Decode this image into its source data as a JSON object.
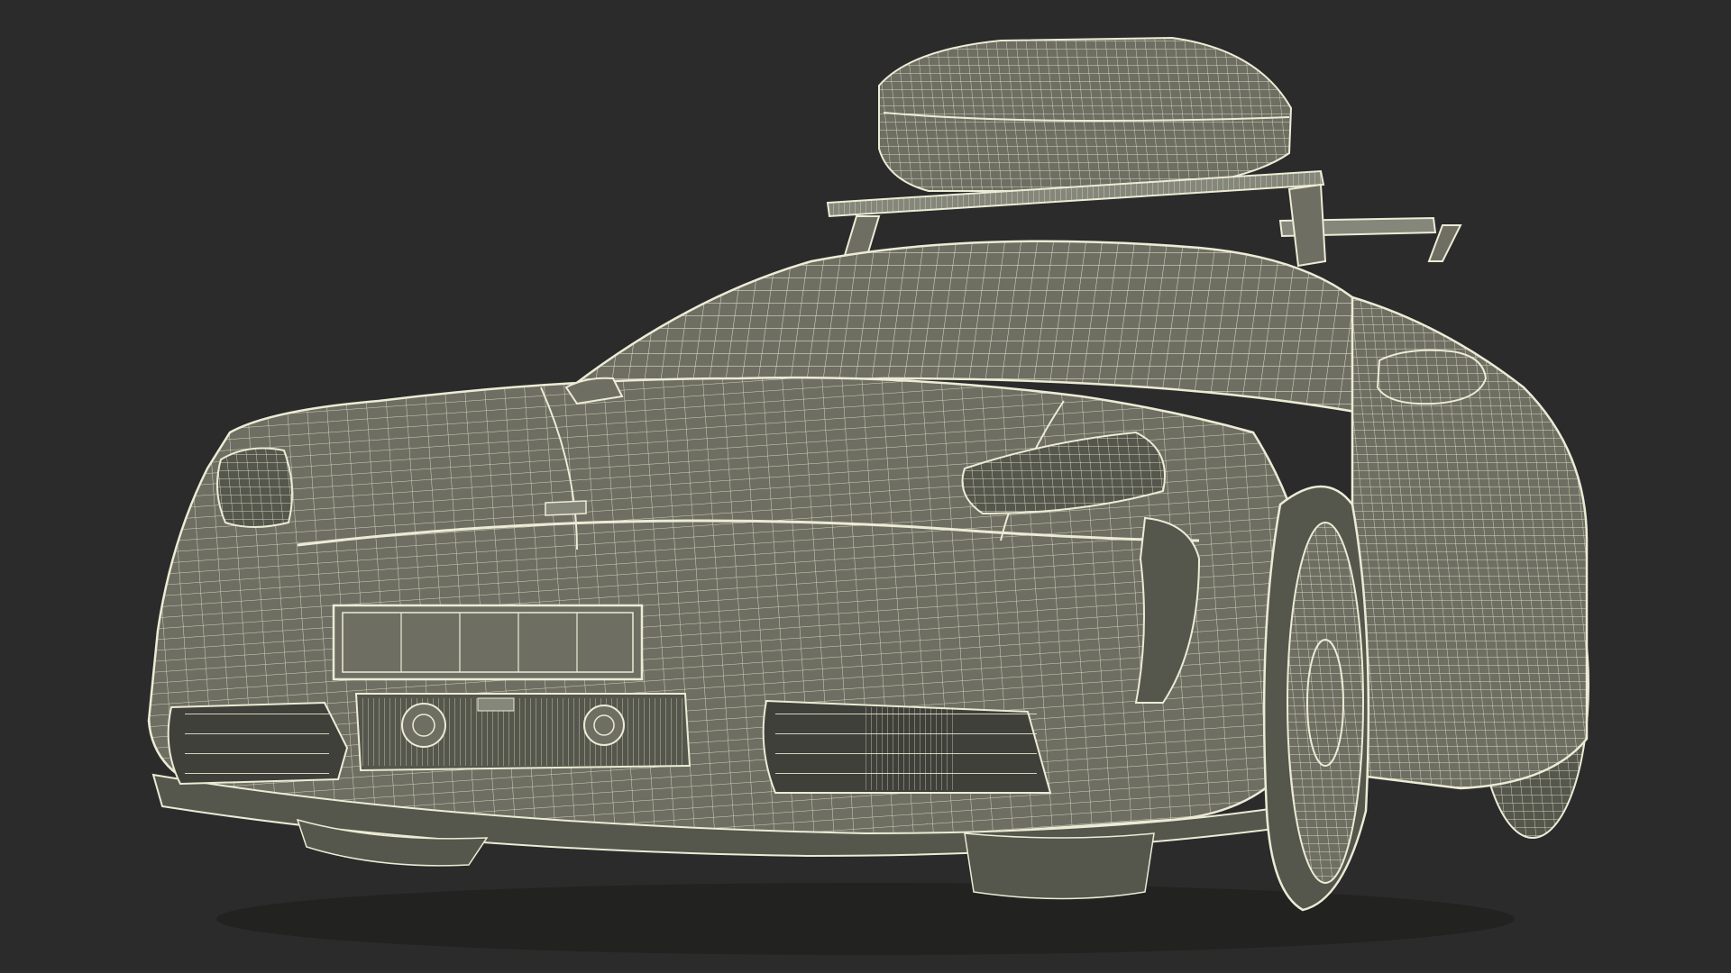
{
  "scene": {
    "subject": "wireframe-render-sports-car-with-roof-box",
    "colors": {
      "background": "#2b2b2b",
      "mesh_fill": "#6e6f62",
      "mesh_fill_dark": "#55574c",
      "mesh_fill_light": "#85877a",
      "wire": "#ecebd6",
      "shadow": "#222220"
    }
  }
}
